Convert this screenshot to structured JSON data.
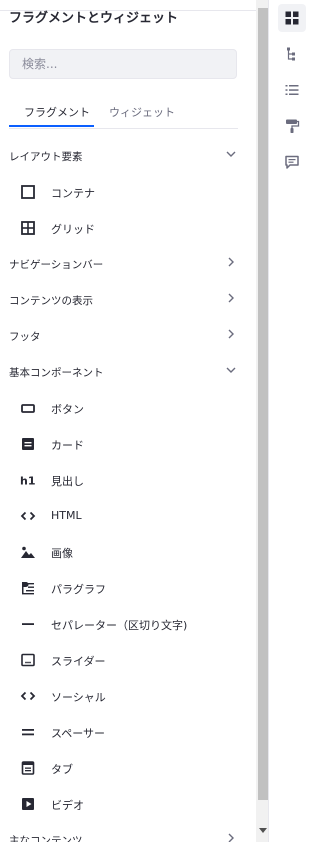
{
  "panel": {
    "title": "フラグメントとウィジェット",
    "search_placeholder": "検索...",
    "tabs": [
      {
        "label": "フラグメント",
        "active": true
      },
      {
        "label": "ウィジェット",
        "active": false
      }
    ]
  },
  "categories": {
    "layout": {
      "label": "レイアウト要素",
      "expanded": true
    },
    "navbar": {
      "label": "ナビゲーションバー",
      "expanded": false
    },
    "content_display": {
      "label": "コンテンツの表示",
      "expanded": false
    },
    "footer": {
      "label": "フッタ",
      "expanded": false
    },
    "basic": {
      "label": "基本コンポーネント",
      "expanded": true
    },
    "main_content": {
      "label": "主なコンテンツ",
      "expanded": false
    }
  },
  "layout_items": [
    {
      "label": "コンテナ",
      "icon": "container-icon"
    },
    {
      "label": "グリッド",
      "icon": "grid-icon"
    }
  ],
  "basic_items": [
    {
      "label": "ボタン",
      "icon": "button-icon"
    },
    {
      "label": "カード",
      "icon": "card-icon"
    },
    {
      "label": "見出し",
      "icon": "heading-icon"
    },
    {
      "label": "HTML",
      "icon": "code-icon"
    },
    {
      "label": "画像",
      "icon": "image-icon"
    },
    {
      "label": "パラグラフ",
      "icon": "paragraph-icon"
    },
    {
      "label": "セパレーター（区切り文字)",
      "icon": "separator-icon"
    },
    {
      "label": "スライダー",
      "icon": "slider-icon"
    },
    {
      "label": "ソーシャル",
      "icon": "social-icon"
    },
    {
      "label": "スペーサー",
      "icon": "spacer-icon"
    },
    {
      "label": "タブ",
      "icon": "tabs-icon"
    },
    {
      "label": "ビデオ",
      "icon": "video-icon"
    }
  ],
  "sidebar_tools": [
    {
      "name": "fragments-widgets-icon",
      "active": true
    },
    {
      "name": "page-structure-icon",
      "active": false
    },
    {
      "name": "list-icon",
      "active": false
    },
    {
      "name": "look-and-feel-icon",
      "active": false
    },
    {
      "name": "comments-icon",
      "active": false
    }
  ],
  "colors": {
    "accent": "#0b5fff",
    "text": "#272833",
    "muted": "#6b6c7e"
  }
}
